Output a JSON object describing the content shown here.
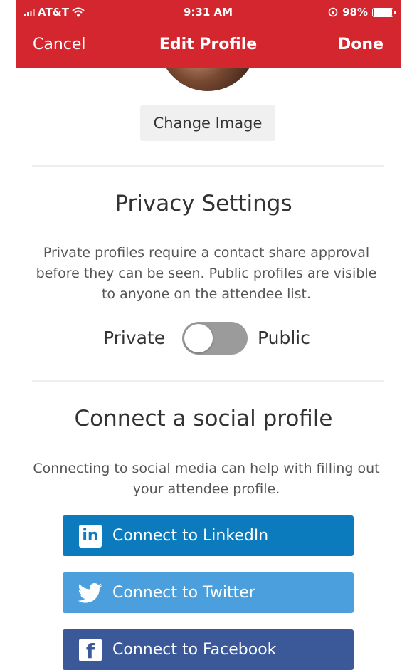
{
  "status_bar": {
    "carrier": "AT&T",
    "time": "9:31 AM",
    "battery": "98%"
  },
  "nav": {
    "cancel_label": "Cancel",
    "title": "Edit Profile",
    "done_label": "Done"
  },
  "profile": {
    "change_image_label": "Change Image"
  },
  "privacy": {
    "title": "Privacy Settings",
    "description": "Private profiles require a contact share approval before they can be seen. Public profiles are visible to anyone on the attendee list.",
    "private_label": "Private",
    "public_label": "Public",
    "toggle_state": "private"
  },
  "social": {
    "title": "Connect a social profile",
    "description": "Connecting to social media can help with filling out your attendee profile.",
    "buttons": [
      {
        "label": "Connect to LinkedIn",
        "icon": "linkedin-icon",
        "color": "#0b7bbd"
      },
      {
        "label": "Connect to Twitter",
        "icon": "twitter-icon",
        "color": "#4a9fdc"
      },
      {
        "label": "Connect to Facebook",
        "icon": "facebook-icon",
        "color": "#3b5998"
      }
    ]
  },
  "colors": {
    "header": "#d3262e",
    "toggle_off": "#9b9b9b"
  }
}
